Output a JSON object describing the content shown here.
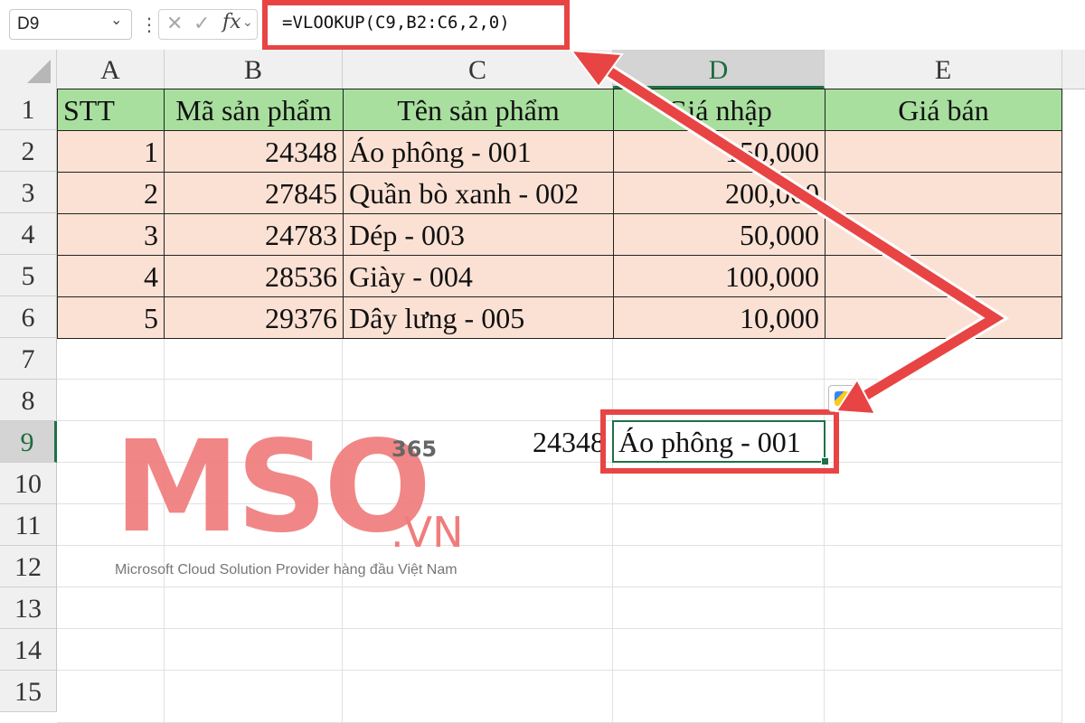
{
  "formula_bar": {
    "name_box": "D9",
    "formula": "=VLOOKUP(C9,B2:C6,2,0)",
    "icons": {
      "dropdown": "chevron-down-icon",
      "more": "vertical-dots-icon",
      "cancel": "x-icon",
      "enter": "check-icon",
      "function": "fx-icon"
    }
  },
  "columns": [
    "A",
    "B",
    "C",
    "D",
    "E"
  ],
  "rows": [
    "1",
    "2",
    "3",
    "4",
    "5",
    "6",
    "7",
    "8",
    "9",
    "10",
    "11",
    "12",
    "13",
    "14",
    "15"
  ],
  "table": {
    "headers": [
      "STT",
      "Mã sản phẩm",
      "Tên sản phẩm",
      "Giá nhập",
      "Giá bán"
    ],
    "data": [
      [
        "1",
        "24348",
        "Áo phông - 001",
        "150,000",
        ""
      ],
      [
        "2",
        "27845",
        "Quần bò xanh - 002",
        "200,000",
        ""
      ],
      [
        "3",
        "24783",
        "Dép - 003",
        "50,000",
        ""
      ],
      [
        "4",
        "28536",
        "Giày - 004",
        "100,000",
        ""
      ],
      [
        "5",
        "29376",
        "Dây lưng - 005",
        "10,000",
        ""
      ]
    ]
  },
  "row9": {
    "c9": "24348",
    "d9": "Áo phông - 001"
  },
  "selection": {
    "active_cell": "D9",
    "active_column": "D",
    "active_row": "9"
  },
  "watermark": {
    "logo": "MSO",
    "superscript": "365",
    "suffix": ".VN",
    "tagline": "Microsoft Cloud Solution Provider hàng đầu Việt Nam"
  },
  "colors": {
    "header_fill": "#a8df9e",
    "data_fill": "#fbe1d4",
    "annotation_red": "#e84444",
    "selection_green": "#1e7145",
    "logo_pink": "#f07c7c"
  }
}
